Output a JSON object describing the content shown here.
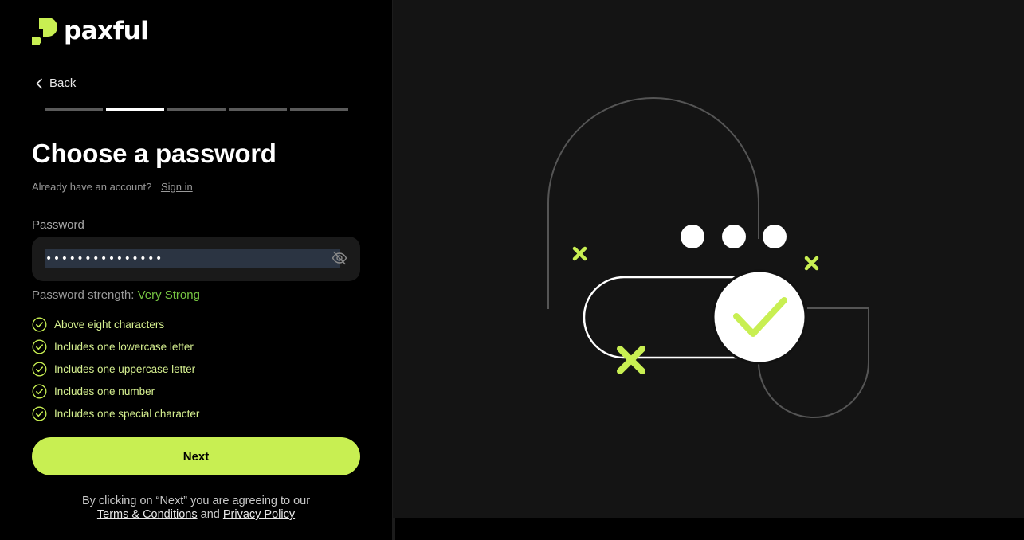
{
  "brand": {
    "name": "paxful",
    "accent": "#c8ef52"
  },
  "nav": {
    "back_label": "Back"
  },
  "progress": {
    "total_steps": 5,
    "current_step": 2
  },
  "form": {
    "title": "Choose a password",
    "signin_prompt": "Already have an account?",
    "signin_link": "Sign in",
    "password_label": "Password",
    "password_value": "•••••••••••••••",
    "strength_label": "Password strength:",
    "strength_value": "Very Strong",
    "requirements": [
      "Above eight characters",
      "Includes one lowercase letter",
      "Includes one uppercase letter",
      "Includes one number",
      "Includes one special character"
    ],
    "next_label": "Next"
  },
  "legal": {
    "prefix": "By clicking on “Next” you are agreeing to our",
    "terms_link": "Terms & Conditions",
    "and": "and",
    "privacy_link": "Privacy Policy"
  },
  "icons": {
    "back": "chevron-left-icon",
    "visibility": "eye-off-icon",
    "requirement": "check-circle-icon"
  }
}
